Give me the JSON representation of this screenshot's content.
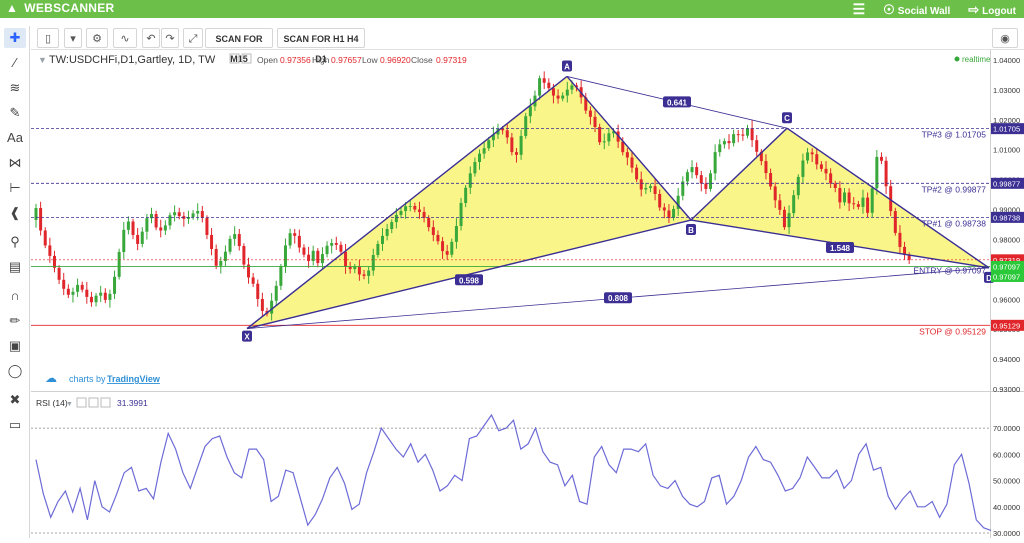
{
  "app": {
    "brand": "WEBSCANNER",
    "nav": {
      "social_wall": "Social Wall",
      "logout": "Logout"
    }
  },
  "toolbar": {
    "scan_m15": "SCAN FOR M15",
    "scan_h1h4d1": "SCAN FOR H1 H4 D1"
  },
  "legend": {
    "symbol": "TW:USDCHFi,D1,Gartley, 1D, TW",
    "open_label": "Open",
    "open": "0.97356",
    "high_label": "High",
    "high": "0.97657",
    "low_label": "Low",
    "low": "0.96920",
    "close_label": "Close",
    "close": "0.97319",
    "realtime": "realtime"
  },
  "watermark": {
    "prefix": "charts by",
    "brand": "TradingView"
  },
  "rsi": {
    "label": "RSI (14)",
    "value": "31.3991"
  },
  "colors": {
    "up": "#39a83b",
    "down": "#e0262b",
    "pattern_fill": "#f7f36b",
    "pattern_line": "#3b2f93",
    "rsi": "#6d6bd6"
  },
  "chart_data": [
    {
      "type": "candlestick",
      "title": "TW:USDCHFi,D1,Gartley, 1D, TW",
      "ylim": [
        0.93,
        1.04
      ],
      "y_ticks": [
        "1.04000",
        "1.03000",
        "1.02000",
        "1.01000",
        "1.00000",
        "0.99000",
        "0.98000",
        "0.97000",
        "0.96000",
        "0.95000",
        "0.94000",
        "0.93000"
      ],
      "price_tags": [
        {
          "label": "1.01705",
          "value": 1.01705
        },
        {
          "label": "0.99877",
          "value": 0.99877
        },
        {
          "label": "0.98738",
          "value": 0.98738
        },
        {
          "label": "0.97319",
          "value": 0.97319
        },
        {
          "label": "0.97097",
          "value": 0.97097
        },
        {
          "label": "0.97097",
          "value": 0.97097
        },
        {
          "label": "0.95129",
          "value": 0.95129
        }
      ],
      "levels": [
        {
          "label": "TP#3 @ 1.01705",
          "value": 1.01705
        },
        {
          "label": "TP#2 @ 0.99877",
          "value": 0.99877
        },
        {
          "label": "TP#1 @ 0.98738",
          "value": 0.98738
        },
        {
          "label": "ENTRY @ 0.97097",
          "value": 0.97097
        },
        {
          "label": "STOP @ 0.95129",
          "value": 0.95129
        }
      ],
      "pattern_points": [
        {
          "label": "X",
          "price": 0.9502
        },
        {
          "label": "A",
          "price": 1.0345
        },
        {
          "label": "B",
          "price": 0.9865
        },
        {
          "label": "C",
          "price": 1.0172
        },
        {
          "label": "D",
          "price": 0.9705
        }
      ],
      "ratios": [
        "0.641",
        "0.598",
        "1.548",
        "0.808"
      ],
      "close_series": [
        0.9905,
        0.983,
        0.978,
        0.9745,
        0.9705,
        0.9665,
        0.9635,
        0.9615,
        0.9625,
        0.9648,
        0.9632,
        0.9608,
        0.959,
        0.9612,
        0.9622,
        0.9598,
        0.9618,
        0.9675,
        0.9758,
        0.9832,
        0.986,
        0.9815,
        0.9785,
        0.9826,
        0.9871,
        0.9885,
        0.984,
        0.983,
        0.9847,
        0.9881,
        0.9891,
        0.9878,
        0.9869,
        0.9875,
        0.9887,
        0.9895,
        0.9872,
        0.9815,
        0.9768,
        0.9712,
        0.9728,
        0.9759,
        0.9802,
        0.9818,
        0.9778,
        0.9716,
        0.9673,
        0.9652,
        0.9601,
        0.9561,
        0.9552,
        0.9595,
        0.9645,
        0.9709,
        0.978,
        0.9821,
        0.9812,
        0.9773,
        0.9749,
        0.9728,
        0.9762,
        0.9721,
        0.9751,
        0.9779,
        0.9788,
        0.9782,
        0.9759,
        0.9708,
        0.9701,
        0.9709,
        0.9683,
        0.9678,
        0.9696,
        0.9748,
        0.9785,
        0.9812,
        0.9835,
        0.9858,
        0.9882,
        0.9895,
        0.9911,
        0.9912,
        0.99,
        0.9892,
        0.9872,
        0.9841,
        0.9815,
        0.9794,
        0.9761,
        0.9749,
        0.9792,
        0.9845,
        0.9922,
        0.9973,
        1.0021,
        1.0059,
        1.0087,
        1.0105,
        1.0132,
        1.0151,
        1.017,
        1.0165,
        1.0141,
        1.0092,
        1.0083,
        1.0146,
        1.0212,
        1.0245,
        1.0281,
        1.0339,
        1.0324,
        1.0306,
        1.0281,
        1.0271,
        1.0281,
        1.0301,
        1.0315,
        1.0309,
        1.0275,
        1.0231,
        1.021,
        1.0176,
        1.0125,
        1.0128,
        1.0155,
        1.0161,
        1.0127,
        1.0092,
        1.0074,
        1.004,
        1.0001,
        0.9967,
        0.9972,
        0.9978,
        0.9952,
        0.9907,
        0.9897,
        0.9872,
        0.9902,
        0.9946,
        0.9994,
        1.0025,
        1.0042,
        1.0015,
        0.9987,
        0.9969,
        1.0021,
        1.0092,
        1.0118,
        1.0129,
        1.0122,
        1.0152,
        1.0151,
        1.0147,
        1.0172,
        1.0132,
        1.0093,
        1.0062,
        1.0022,
        0.9977,
        0.9931,
        0.9899,
        0.9841,
        0.9888,
        0.9948,
        1.0009,
        1.0064,
        1.0091,
        1.0085,
        1.0051,
        1.0036,
        1.0021,
        0.9987,
        0.9972,
        0.9924,
        0.9957,
        0.9921,
        0.9918,
        0.9909,
        0.994,
        0.9889,
        0.9971,
        1.0076,
        1.0063,
        0.9978,
        0.9895,
        0.9822,
        0.9775,
        0.9748,
        0.9732
      ]
    },
    {
      "type": "line",
      "title": "RSI (14)",
      "ylim": [
        30,
        75
      ],
      "y_ticks": [
        "70.0000",
        "60.0000",
        "50.0000",
        "40.0000",
        "30.0000"
      ],
      "levels": [
        70,
        30
      ],
      "values": [
        58,
        45,
        36,
        42,
        46,
        38,
        47,
        35,
        50,
        40,
        38,
        45,
        53,
        55,
        46,
        47,
        43,
        57,
        68,
        62,
        53,
        47,
        55,
        63,
        66,
        67,
        59,
        53,
        51,
        62,
        62,
        58,
        42,
        44,
        54,
        53,
        43,
        33,
        37,
        43,
        51,
        55,
        49,
        39,
        41,
        53,
        61,
        70,
        66,
        62,
        59,
        64,
        57,
        60,
        54,
        46,
        48,
        52,
        50,
        66,
        67,
        71,
        75,
        69,
        70,
        73,
        62,
        64,
        70,
        61,
        57,
        56,
        48,
        52,
        42,
        41,
        59,
        63,
        56,
        53,
        62,
        62,
        61,
        64,
        52,
        48,
        47,
        50,
        44,
        41,
        40,
        42,
        51,
        52,
        41,
        44,
        50,
        59,
        63,
        58,
        57,
        52,
        46,
        47,
        51,
        59,
        55,
        51,
        51,
        54,
        47,
        50,
        60,
        64,
        54,
        55,
        44,
        39,
        43,
        46,
        40,
        40,
        42,
        36,
        41,
        56,
        60,
        49,
        35,
        32,
        31
      ]
    }
  ]
}
